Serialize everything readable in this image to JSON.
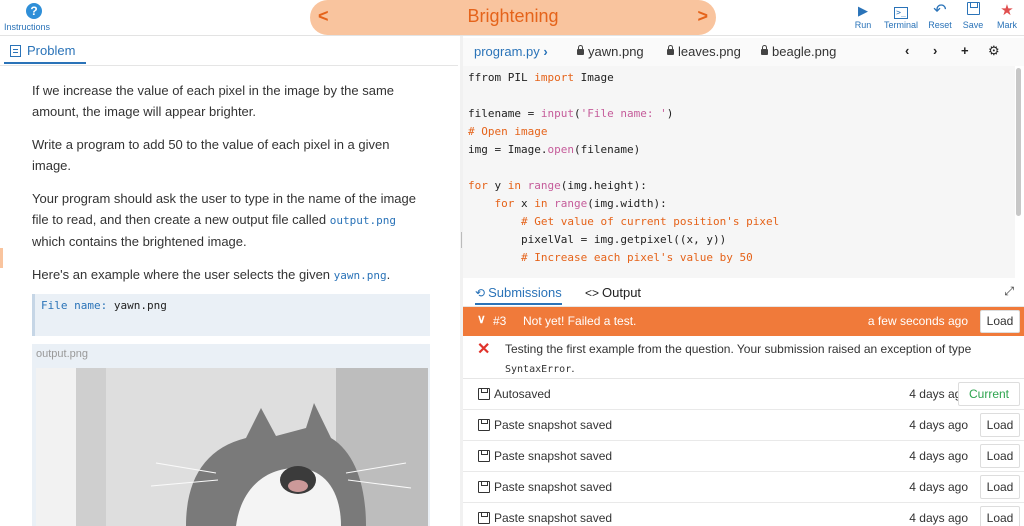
{
  "topbar": {
    "instructions_label": "Instructions",
    "title": "Brightening",
    "prev_glyph": "<",
    "next_glyph": ">",
    "tools": {
      "run": "Run",
      "terminal": "Terminal",
      "reset": "Reset",
      "save": "Save",
      "mark": "Mark"
    },
    "accent": "#e5631a",
    "link_color": "#2a73b8"
  },
  "problem": {
    "tab_label": "Problem",
    "para1": "If we increase the value of each pixel in the image by the same amount, the image will appear brighter.",
    "para2": "Write a program to add 50 to the value of each pixel in a given image.",
    "para3_a": "Your program should ask the user to type in the name of the image file to read, and then create a new output file called ",
    "para3_code": "output.png",
    "para3_b": " which contains the brightened image.",
    "para4_a": "Here's an example where the user selects the given ",
    "para4_code": "yawn.png",
    "para4_b": ".",
    "example_prompt": "File name:",
    "example_input": "yawn.png",
    "output_caption": "output.png"
  },
  "editor": {
    "tabs": [
      {
        "label": "program.py",
        "locked": false
      },
      {
        "label": "yawn.png",
        "locked": true
      },
      {
        "label": "leaves.png",
        "locked": true
      },
      {
        "label": "beagle.png",
        "locked": true
      }
    ],
    "nav": {
      "prev": "‹",
      "next": "›",
      "add": "+",
      "settings": "⚙"
    }
  },
  "bottom": {
    "tabs": {
      "submissions": "Submissions",
      "output": "Output"
    },
    "fail": {
      "number": "#3",
      "message": "Not yet! Failed a test.",
      "time": "a few seconds ago",
      "load": "Load"
    },
    "error_text": "Testing the first example from the question. Your submission raised an exception of type ",
    "error_code": "SyntaxError",
    "error_end": ".",
    "history": [
      {
        "label": "Autosaved",
        "time": "4 days ago",
        "action": "Current"
      },
      {
        "label": "Paste snapshot saved",
        "time": "4 days ago",
        "action": "Load"
      },
      {
        "label": "Paste snapshot saved",
        "time": "4 days ago",
        "action": "Load"
      },
      {
        "label": "Paste snapshot saved",
        "time": "4 days ago",
        "action": "Load"
      },
      {
        "label": "Paste snapshot saved",
        "time": "4 days ago",
        "action": "Load"
      }
    ]
  }
}
